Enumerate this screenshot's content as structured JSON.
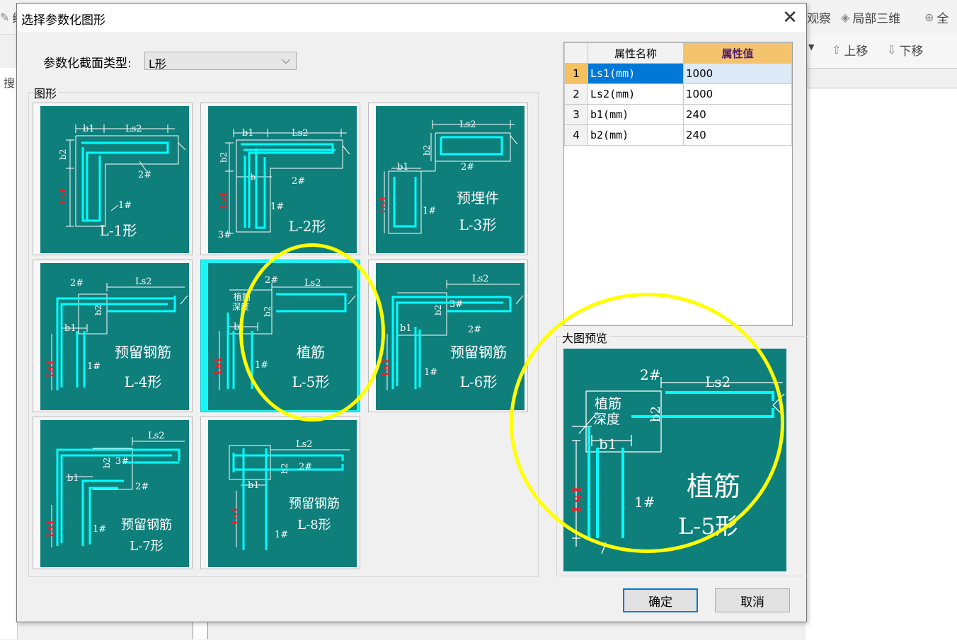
{
  "background": {
    "toolbar_items": [
      {
        "label": "绘",
        "icon": "pencil-icon"
      },
      {
        "label": "观察",
        "icon": "eye-icon"
      },
      {
        "label": "局部三维",
        "icon": "cube-icon"
      },
      {
        "label": "全",
        "icon": "zoom-icon"
      }
    ],
    "move_up_label": "上移",
    "move_down_label": "下移",
    "search_stub": "搜"
  },
  "dialog": {
    "title": "选择参数化图形",
    "section_type_label": "参数化截面类型:",
    "section_type_value": "L形",
    "shapes_group_label": "图形",
    "preview_group_label": "大图预览",
    "ok_label": "确定",
    "cancel_label": "取消",
    "shapes": [
      {
        "id": "L-1",
        "caption1": "",
        "caption2": "L-1形"
      },
      {
        "id": "L-2",
        "caption1": "",
        "caption2": "L-2形"
      },
      {
        "id": "L-3",
        "caption1": "预埋件",
        "caption2": "L-3形"
      },
      {
        "id": "L-4",
        "caption1": "预留钢筋",
        "caption2": "L-4形"
      },
      {
        "id": "L-5",
        "caption1": "植筋",
        "caption2": "L-5形",
        "selected": true
      },
      {
        "id": "L-6",
        "caption1": "预留钢筋",
        "caption2": "L-6形"
      },
      {
        "id": "L-7",
        "caption1": "预留钢筋",
        "caption2": "L-7形"
      },
      {
        "id": "L-8",
        "caption1": "预留钢筋",
        "caption2": "L-8形"
      }
    ],
    "diagram_labels": {
      "b1": "b1",
      "b2": "b2",
      "ls1": "Ls1",
      "ls2": "Ls2",
      "bar1": "1#",
      "bar2": "2#",
      "bar3": "3#",
      "depth1": "植筋",
      "depth2": "深度"
    },
    "properties": {
      "header_name": "属性名称",
      "header_value": "属性值",
      "rows": [
        {
          "num": "1",
          "name": "Ls1(mm)",
          "value": "1000"
        },
        {
          "num": "2",
          "name": "Ls2(mm)",
          "value": "1000"
        },
        {
          "num": "3",
          "name": "b1(mm)",
          "value": "240"
        },
        {
          "num": "4",
          "name": "b2(mm)",
          "value": "240"
        }
      ]
    },
    "preview": {
      "caption1": "植筋",
      "caption2": "L-5形"
    }
  },
  "colors": {
    "tile_bg": "#0f7f7c",
    "rebar": "#00ffff",
    "highlight": "#ffff00",
    "selected_tile": "#19f5f5",
    "ls1_red": "#e8202a"
  }
}
